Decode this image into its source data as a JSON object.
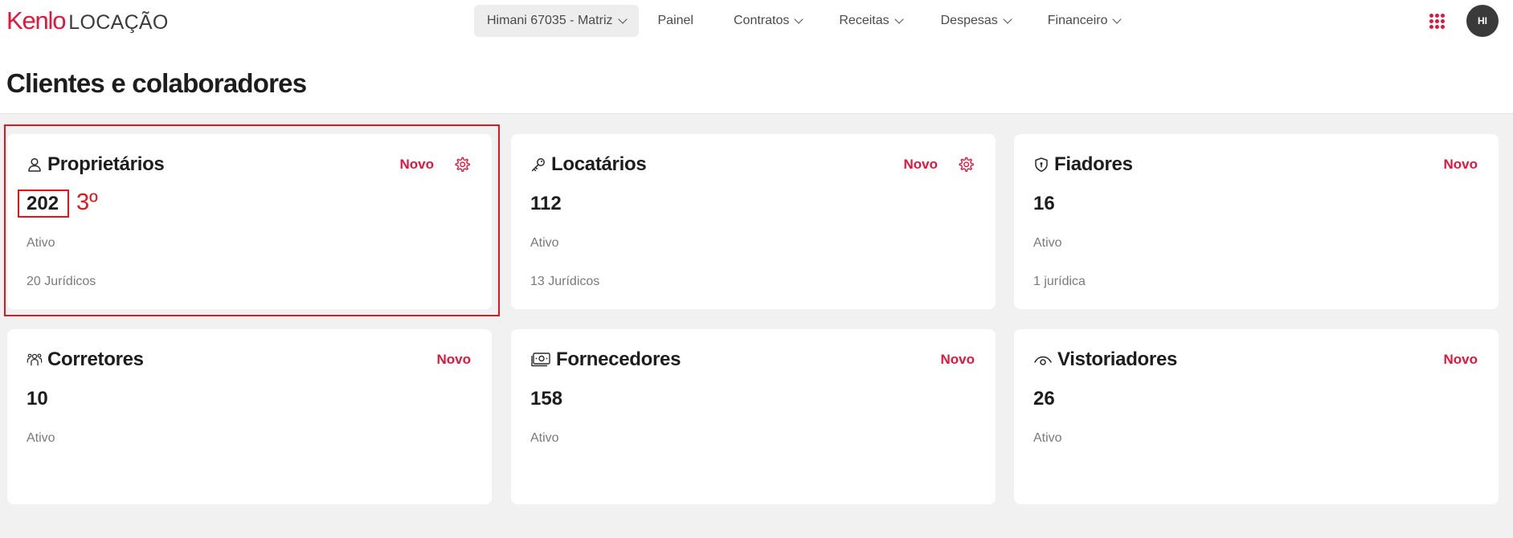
{
  "brand": {
    "name": "Kenlo",
    "product": "LOCAÇÃO",
    "accent": "#e0173c"
  },
  "nav": {
    "branch": "Himani 67035 - Matriz",
    "items": [
      {
        "label": "Painel",
        "has_dropdown": false
      },
      {
        "label": "Contratos",
        "has_dropdown": true
      },
      {
        "label": "Receitas",
        "has_dropdown": true
      },
      {
        "label": "Despesas",
        "has_dropdown": true
      },
      {
        "label": "Financeiro",
        "has_dropdown": true
      }
    ],
    "apps_icon": "grid-dots-icon",
    "avatar_initials": "HI"
  },
  "page": {
    "title": "Clientes e colaboradores"
  },
  "cards": [
    {
      "title": "Proprietários",
      "icon": "user-icon",
      "action": "Novo",
      "has_settings": true,
      "count": "202",
      "status": "Ativo",
      "sub": "20 Jurídicos"
    },
    {
      "title": "Locatários",
      "icon": "key-icon",
      "action": "Novo",
      "has_settings": true,
      "count": "112",
      "status": "Ativo",
      "sub": "13 Jurídicos"
    },
    {
      "title": "Fiadores",
      "icon": "shield-icon",
      "action": "Novo",
      "has_settings": false,
      "count": "16",
      "status": "Ativo",
      "sub": "1 jurídica"
    },
    {
      "title": "Corretores",
      "icon": "team-icon",
      "action": "Novo",
      "has_settings": false,
      "count": "10",
      "status": "Ativo"
    },
    {
      "title": "Fornecedores",
      "icon": "money-icon",
      "action": "Novo",
      "has_settings": false,
      "count": "158",
      "status": "Ativo"
    },
    {
      "title": "Vistoriadores",
      "icon": "eye-icon",
      "action": "Novo",
      "has_settings": false,
      "count": "26",
      "status": "Ativo"
    }
  ],
  "annotation": {
    "text": "3º",
    "color": "#e3171b"
  }
}
